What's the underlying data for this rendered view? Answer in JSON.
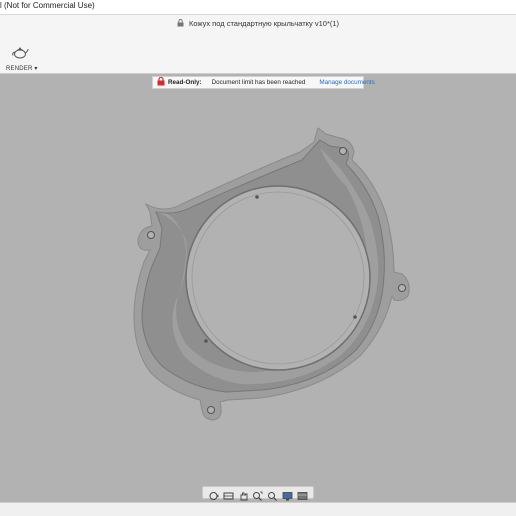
{
  "window": {
    "title": "l (Not for Commercial Use)"
  },
  "document": {
    "title": "Кожух под стандартную крыльчатку v10*(1)"
  },
  "toolbar": {
    "workspace_label": "RENDER ▾"
  },
  "banner": {
    "label": "Read-Only:",
    "message": "Document limit has been reached",
    "link": "Manage documents"
  },
  "navigation_bar": {
    "icons": [
      "orbit-icon",
      "look-at-icon",
      "pan-icon",
      "zoom-window-icon",
      "zoom-icon",
      "display-settings-icon",
      "visual-style-icon"
    ]
  },
  "colors": {
    "viewport_background": "#b2b2b2",
    "model_surface": "#8e8e8e",
    "accent_link": "#1c6cc8",
    "readonly_icon": "#d62b2b"
  }
}
